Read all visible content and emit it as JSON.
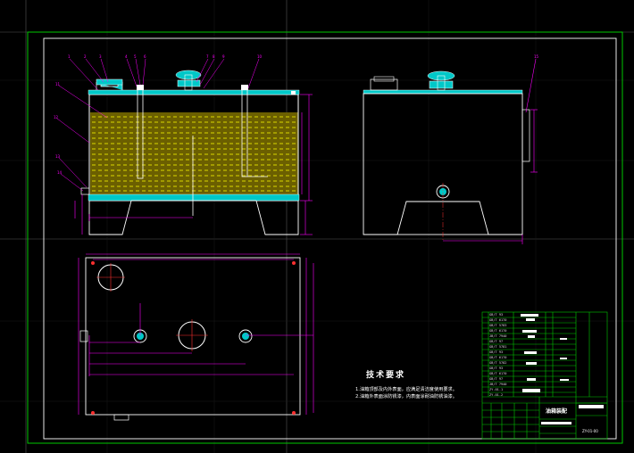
{
  "drawing": {
    "tech_requirements_title": "技术要求",
    "notes": [
      "1.油箱顶部及内外表面，应满足清洁度使用要求。",
      "2.油箱外表面涂防锈漆，内表面涂耐油防锈油漆。"
    ],
    "title_block": {
      "name": "油箱装配",
      "code": "ZY-01-00",
      "parts": [
        "GB/T 93",
        "GB/T 6170",
        "GB/T 5783",
        "GB/T 6170",
        "JB/T 7940",
        "GB/T 97",
        "GB/T 5781",
        "GB/T 93",
        "GB/T 6170",
        "GB/T 5782",
        "GB/T 93",
        "GB/T 6170",
        "GB/T 97",
        "JB/T 7940",
        "ZY-01-1",
        "ZY-01-2"
      ]
    }
  },
  "colors": {
    "background": "#000000",
    "border": "#00c800",
    "frame": "#ffffff",
    "outline": "#ffffff",
    "dimension": "#ff00ff",
    "fluid_fill": "#8a7a00",
    "fluid_hatch": "#ffff00",
    "cyan": "#00c8c8",
    "center": "#ff3030",
    "leader": "#ff00ff"
  }
}
